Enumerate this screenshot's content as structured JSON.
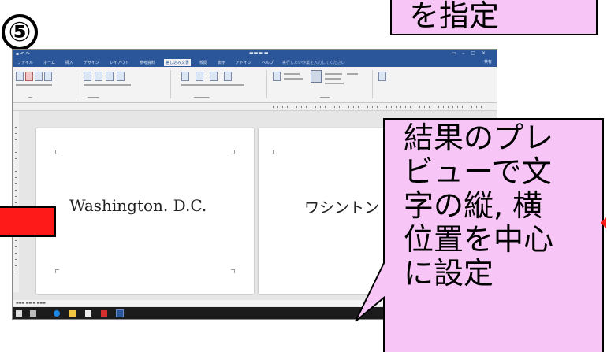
{
  "step_number": "⑤",
  "top_callout": "を指定",
  "main_callout": "結果のプレ\nビューで文\n字の縦, 横\n位置を中心\nに設定",
  "word": {
    "tabs": [
      "ファイル",
      "ホーム",
      "挿入",
      "デザイン",
      "レイアウト",
      "参考資料",
      "差し込み文書",
      "校閲",
      "表示",
      "アドイン",
      "ヘルプ"
    ],
    "active_tab_index": 6,
    "tell_me": "実行したい作業を入力してください",
    "user": "共有",
    "label_left": "Washington. D.C.",
    "label_right": "ワシントン",
    "colors": {
      "title_bar": "#2b579a",
      "ribbon": "#f3f3f3",
      "canvas": "#e6e6e6"
    }
  },
  "colors": {
    "callout_fill": "#f7c6f7",
    "arrow_fill": "#ff1a1a"
  }
}
